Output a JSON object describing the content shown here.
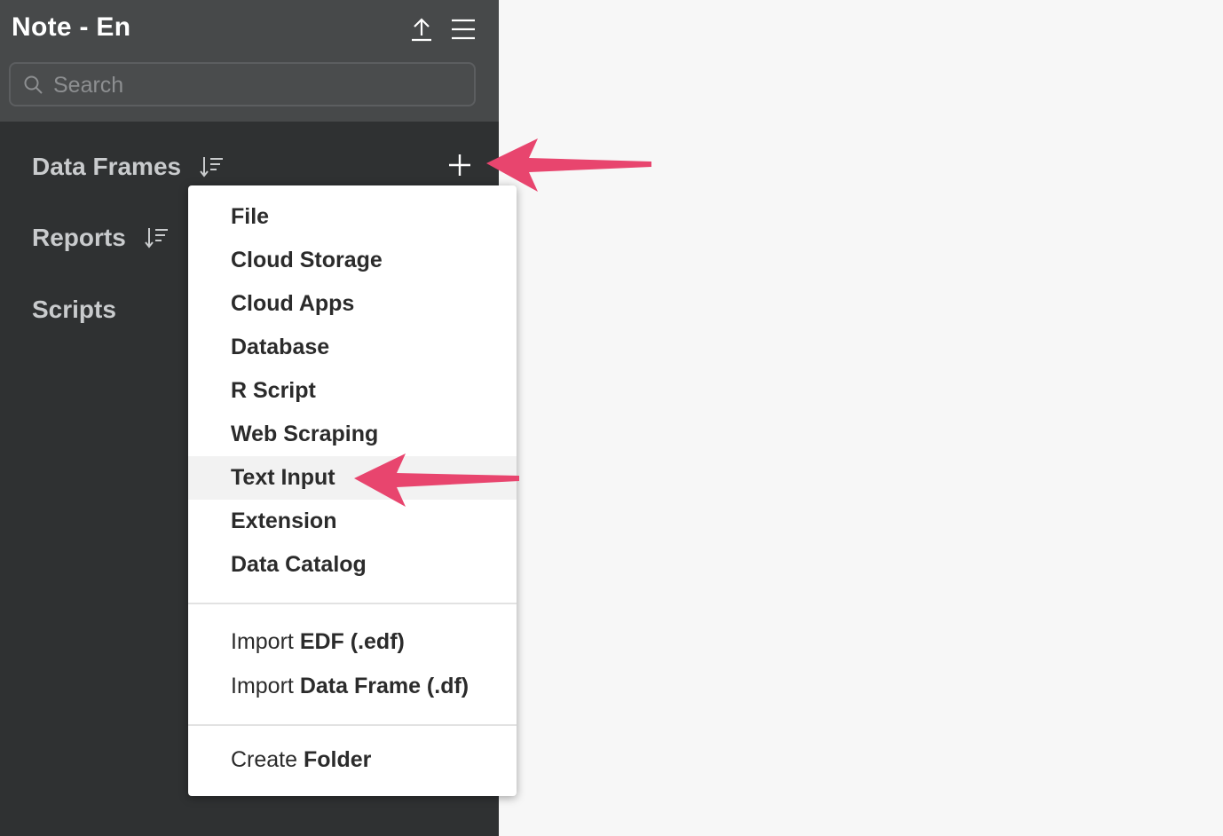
{
  "header": {
    "title": "Note - En",
    "upload_icon": "upload-icon",
    "menu_icon": "hamburger-menu-icon"
  },
  "search": {
    "placeholder": "Search",
    "value": ""
  },
  "sidebar": {
    "sections": [
      {
        "label": "Data Frames",
        "sort_icon": "sort-icon",
        "add_icon": "plus-icon"
      },
      {
        "label": "Reports",
        "sort_icon": "sort-icon"
      },
      {
        "label": "Scripts"
      }
    ]
  },
  "dropdown": {
    "items": [
      "File",
      "Cloud Storage",
      "Cloud Apps",
      "Database",
      "R Script",
      "Web Scraping",
      "Text Input",
      "Extension",
      "Data Catalog"
    ],
    "highlighted_item": "Text Input",
    "import_edf": {
      "prefix": "Import",
      "bold": "EDF (.edf)"
    },
    "import_df": {
      "prefix": "Import",
      "bold": "Data Frame (.df)"
    },
    "create_folder": {
      "prefix": "Create",
      "bold": "Folder"
    }
  },
  "colors": {
    "sidebar_bg": "#2f3132",
    "topbar_bg": "#47494a",
    "annotation_arrow": "#e8456e"
  }
}
